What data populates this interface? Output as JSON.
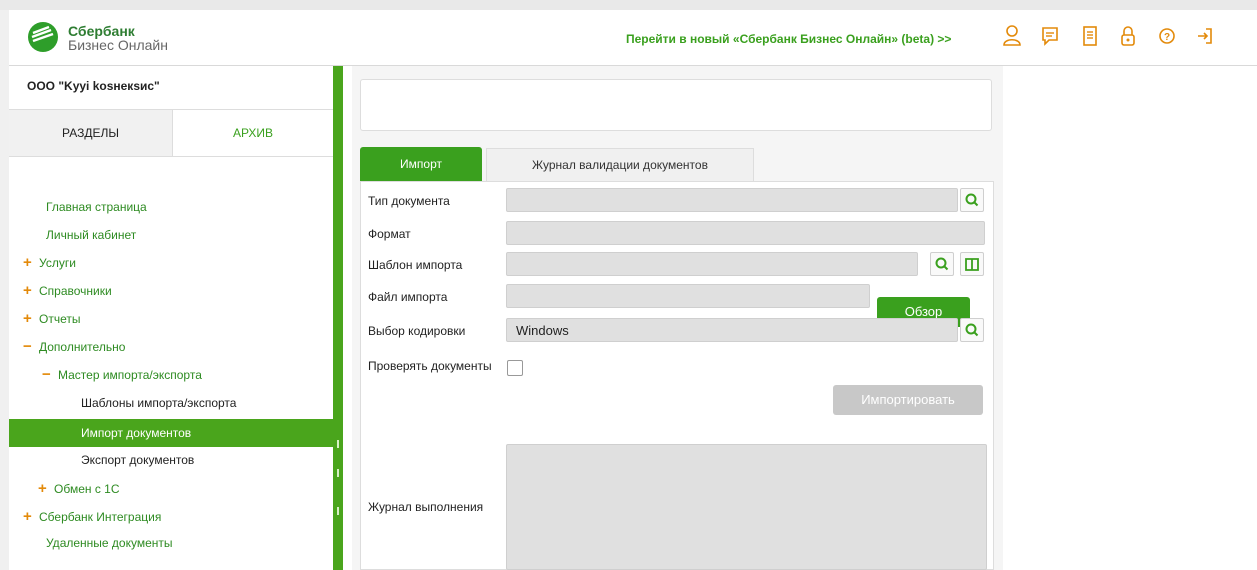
{
  "header": {
    "logo_title": "Сбербанк",
    "logo_subtitle": "Бизнес Онлайн",
    "new_link": "Перейти в новый «Сбербанк Бизнес Онлайн» (beta) >>",
    "icons": [
      "user-icon",
      "chat-icon",
      "document-icon",
      "lock-icon",
      "help-icon",
      "logout-icon"
    ],
    "accent": "#3aa01e"
  },
  "sidebar": {
    "org": "ООО \"Kyyi kosнeкsиc\"",
    "tab_sections": "РАЗДЕЛЫ",
    "tab_archive": "АРХИВ",
    "items": [
      {
        "label": "Главная страница"
      },
      {
        "label": "Личный кабинет"
      },
      {
        "label": "Услуги",
        "marker": "+"
      },
      {
        "label": "Справочники",
        "marker": "+"
      },
      {
        "label": "Отчеты",
        "marker": "+"
      },
      {
        "label": "Дополнительно",
        "marker": "−"
      },
      {
        "label": "Мастер импорта/экспорта",
        "marker": "−"
      },
      {
        "label": "Шаблоны импорта/экспорта"
      },
      {
        "label": "Импорт документов"
      },
      {
        "label": "Экспорт документов"
      },
      {
        "label": "Обмен с 1С",
        "marker": "+"
      },
      {
        "label": "Сбербанк Интеграция",
        "marker": "+"
      },
      {
        "label": "Удаленные документы"
      }
    ]
  },
  "main": {
    "tabs": [
      {
        "label": "Импорт"
      },
      {
        "label": "Журнал валидации документов"
      }
    ],
    "form": {
      "doc_type_label": "Тип документа",
      "format_label": "Формат",
      "template_label": "Шаблон импорта",
      "file_label": "Файл импорта",
      "encoding_label": "Выбор кодировки",
      "encoding_value": "Windows",
      "check_docs_label": "Проверять документы",
      "browse_button": "Обзор",
      "import_button": "Импортировать",
      "log_label": "Журнал выполнения"
    }
  }
}
